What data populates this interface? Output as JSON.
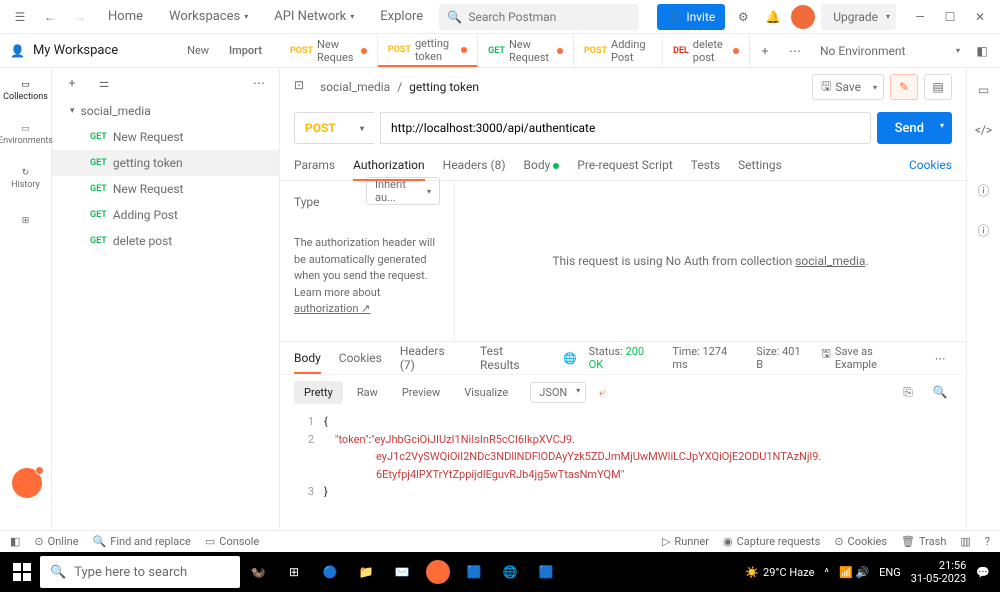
{
  "topbar": {
    "home": "Home",
    "workspaces": "Workspaces",
    "api_network": "API Network",
    "explore": "Explore",
    "search_placeholder": "Search Postman",
    "invite": "Invite",
    "upgrade": "Upgrade"
  },
  "workspace": {
    "name": "My Workspace",
    "new": "New",
    "import": "Import",
    "env": "No Environment"
  },
  "tabs": [
    {
      "method": "POST",
      "mclass": "m-post",
      "label": "New Reques",
      "dot": true
    },
    {
      "method": "POST",
      "mclass": "m-post",
      "label": "getting token",
      "dot": true,
      "active": true
    },
    {
      "method": "GET",
      "mclass": "m-get",
      "label": "New Request",
      "dot": true
    },
    {
      "method": "POST",
      "mclass": "m-post",
      "label": "Adding Post",
      "dot": false
    },
    {
      "method": "DEL",
      "mclass": "m-del",
      "label": "delete post",
      "dot": true
    }
  ],
  "rail": {
    "collections": "Collections",
    "environments": "Environments",
    "history": "History"
  },
  "tree": {
    "collection": "social_media",
    "items": [
      {
        "method": "GET",
        "mclass": "m-get",
        "label": "New Request"
      },
      {
        "method": "GET",
        "mclass": "m-get",
        "label": "getting token",
        "selected": true
      },
      {
        "method": "GET",
        "mclass": "m-get",
        "label": "New Request"
      },
      {
        "method": "GET",
        "mclass": "m-get",
        "label": "Adding Post"
      },
      {
        "method": "GET",
        "mclass": "m-get",
        "label": "delete post"
      }
    ]
  },
  "breadcrumb": {
    "collection": "social_media",
    "sep": "/",
    "current": "getting token",
    "save": "Save"
  },
  "request": {
    "method": "POST",
    "url": "http://localhost:3000/api/authenticate",
    "send": "Send"
  },
  "req_tabs": {
    "params": "Params",
    "auth": "Authorization",
    "headers": "Headers (8)",
    "body": "Body",
    "prereq": "Pre-request Script",
    "tests": "Tests",
    "settings": "Settings",
    "cookies": "Cookies"
  },
  "auth": {
    "type_label": "Type",
    "type_value": "Inherit au...",
    "desc_1": "The authorization header will be automatically generated when you send the request. Learn more about ",
    "desc_link": "authorization",
    "right_1": "This request is using No Auth from collection ",
    "right_link": "social_media"
  },
  "resp_tabs": {
    "body": "Body",
    "cookies": "Cookies",
    "headers": "Headers (7)",
    "tests": "Test Results"
  },
  "resp_meta": {
    "status_label": "Status:",
    "status": "200 OK",
    "time_label": "Time:",
    "time": "1274 ms",
    "size_label": "Size:",
    "size": "401 B",
    "save_example": "Save as Example"
  },
  "resp_views": {
    "pretty": "Pretty",
    "raw": "Raw",
    "preview": "Preview",
    "visualize": "Visualize",
    "format": "JSON"
  },
  "response_body": {
    "key": "\"token\"",
    "val1": "\"eyJhbGciOiJIUzI1NiIsInR5cCI6IkpXVCJ9.",
    "val2": "eyJ1c2VySWQiOiI2NDc3NDllNDFlODAyYzk5ZDJmMjUwMWIiLCJpYXQiOjE2ODU1NTAzNjl9.",
    "val3": "6Etyfpj4lPXTrYtZppijdlEguvRJb4jg5wTtasNmYQM\""
  },
  "statusbar": {
    "online": "Online",
    "find": "Find and replace",
    "console": "Console",
    "runner": "Runner",
    "capture": "Capture requests",
    "cookies": "Cookies",
    "trash": "Trash"
  },
  "taskbar": {
    "search": "Type here to search",
    "weather": "29°C Haze",
    "lang": "ENG",
    "time": "21:56",
    "date": "31-05-2023"
  }
}
